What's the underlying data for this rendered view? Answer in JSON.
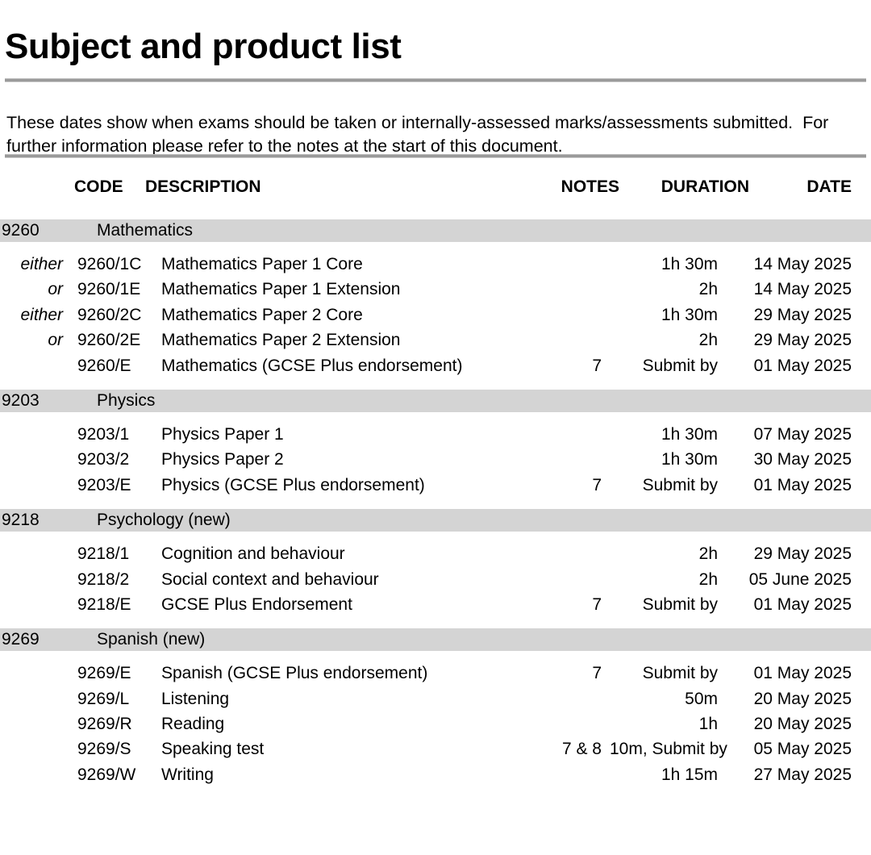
{
  "document": {
    "title": "Subject and product list",
    "intro": "These dates show when exams should be taken or internally-assessed marks/assessments submitted.  For further information please refer to the notes at the start of this document."
  },
  "table": {
    "headers": {
      "either": "",
      "code": "CODE",
      "description": "DESCRIPTION",
      "notes": "NOTES",
      "duration": "DURATION",
      "date": "DATE"
    },
    "sections": [
      {
        "code": "9260",
        "name": "Mathematics",
        "rows": [
          {
            "either": "either",
            "code": "9260/1C",
            "description": "Mathematics Paper 1 Core",
            "notes": "",
            "duration": "1h 30m",
            "date": "14 May 2025"
          },
          {
            "either": "or",
            "code": "9260/1E",
            "description": "Mathematics Paper 1 Extension",
            "notes": "",
            "duration": "2h",
            "date": "14 May 2025"
          },
          {
            "either": "either",
            "code": "9260/2C",
            "description": "Mathematics Paper 2 Core",
            "notes": "",
            "duration": "1h 30m",
            "date": "29 May 2025"
          },
          {
            "either": "or",
            "code": "9260/2E",
            "description": "Mathematics Paper 2 Extension",
            "notes": "",
            "duration": "2h",
            "date": "29 May 2025"
          },
          {
            "either": "",
            "code": "9260/E",
            "description": "Mathematics (GCSE Plus endorsement)",
            "notes": "7",
            "duration": "Submit by",
            "date": "01 May 2025"
          }
        ]
      },
      {
        "code": "9203",
        "name": "Physics",
        "rows": [
          {
            "either": "",
            "code": "9203/1",
            "description": "Physics  Paper 1",
            "notes": "",
            "duration": "1h 30m",
            "date": "07 May 2025"
          },
          {
            "either": "",
            "code": "9203/2",
            "description": "Physics Paper 2",
            "notes": "",
            "duration": "1h 30m",
            "date": "30 May 2025"
          },
          {
            "either": "",
            "code": "9203/E",
            "description": "Physics (GCSE Plus endorsement)",
            "notes": "7",
            "duration": "Submit by",
            "date": "01 May 2025"
          }
        ]
      },
      {
        "code": "9218",
        "name": "Psychology (new)",
        "rows": [
          {
            "either": "",
            "code": "9218/1",
            "description": "Cognition and behaviour",
            "notes": "",
            "duration": "2h",
            "date": "29 May 2025"
          },
          {
            "either": "",
            "code": "9218/2",
            "description": "Social context and behaviour",
            "notes": "",
            "duration": "2h",
            "date": "05 June 2025"
          },
          {
            "either": "",
            "code": "9218/E",
            "description": "GCSE Plus Endorsement",
            "notes": "7",
            "duration": "Submit by",
            "date": "01 May 2025"
          }
        ]
      },
      {
        "code": "9269",
        "name": "Spanish (new)",
        "rows": [
          {
            "either": "",
            "code": "9269/E",
            "description": "Spanish (GCSE Plus endorsement)",
            "notes": "7",
            "duration": "Submit by",
            "date": "01 May 2025"
          },
          {
            "either": "",
            "code": "9269/L",
            "description": "Listening",
            "notes": "",
            "duration": "50m",
            "date": "20 May 2025"
          },
          {
            "either": "",
            "code": "9269/R",
            "description": "Reading",
            "notes": "",
            "duration": "1h",
            "date": "20 May 2025"
          },
          {
            "either": "",
            "code": "9269/S",
            "description": "Speaking test",
            "notes": "7 & 8",
            "duration": "10m, Submit by",
            "date": "05 May 2025"
          },
          {
            "either": "",
            "code": "9269/W",
            "description": "Writing",
            "notes": "",
            "duration": "1h 15m",
            "date": "27 May 2025"
          }
        ]
      }
    ]
  },
  "colors": {
    "section_band": "#d4d4d4",
    "rule": "#9a9a9a",
    "text": "#000000",
    "page_background": "#ffffff"
  }
}
